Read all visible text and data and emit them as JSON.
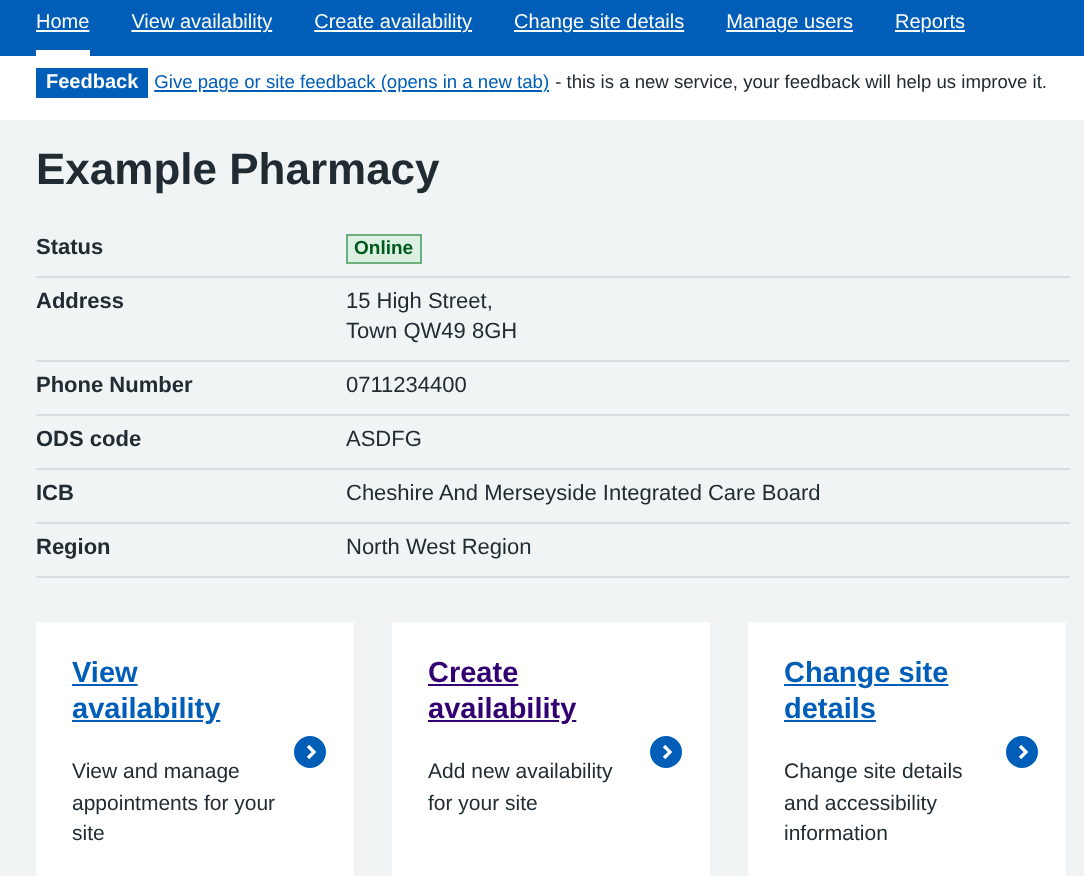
{
  "nav": [
    {
      "label": "Home",
      "selected": true
    },
    {
      "label": "View availability",
      "selected": false
    },
    {
      "label": "Create availability",
      "selected": false
    },
    {
      "label": "Change site details",
      "selected": false
    },
    {
      "label": "Manage users",
      "selected": false
    },
    {
      "label": "Reports",
      "selected": false
    }
  ],
  "feedback": {
    "tag": "Feedback",
    "link": "Give page or site feedback (opens in a new tab)",
    "text": "- this is a new service, your feedback will help us improve it."
  },
  "title": "Example Pharmacy",
  "details": [
    {
      "label": "Status",
      "kind": "tag",
      "value": "Online"
    },
    {
      "label": "Address",
      "kind": "lines",
      "lines": [
        "15 High Street,",
        "Town QW49 8GH"
      ]
    },
    {
      "label": "Phone Number",
      "kind": "text",
      "value": "0711234400"
    },
    {
      "label": "ODS code",
      "kind": "text",
      "value": "ASDFG"
    },
    {
      "label": "ICB",
      "kind": "text",
      "value": "Cheshire And Merseyside Integrated Care Board"
    },
    {
      "label": "Region",
      "kind": "text",
      "value": "North West Region"
    }
  ],
  "cards": [
    {
      "title": "View availability",
      "visited": false,
      "description": "View and manage appointments for your site"
    },
    {
      "title": "Create availability",
      "visited": true,
      "description": "Add new availability for your site"
    },
    {
      "title": "Change site details",
      "visited": false,
      "description": "Change site details and accessibility information"
    }
  ]
}
